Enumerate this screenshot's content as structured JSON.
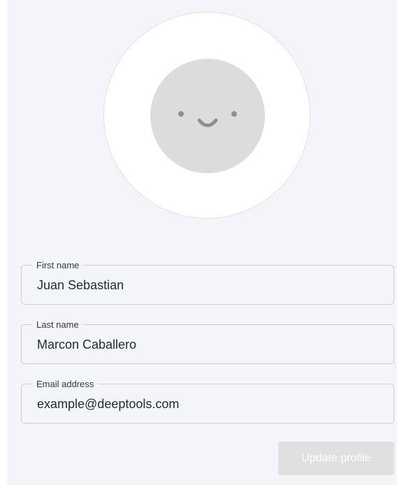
{
  "profile": {
    "avatar": {
      "icon": "smiley-face-icon",
      "ring_color": "#ffffff",
      "face_color": "#dcdcdc"
    },
    "fields": [
      {
        "label": "First name",
        "value": "Juan Sebastian"
      },
      {
        "label": "Last name",
        "value": "Marcon Caballero"
      },
      {
        "label": "Email address",
        "value": "example@deeptools.com"
      }
    ],
    "update_button_label": "Update profile",
    "update_button_state": "disabled"
  },
  "colors": {
    "background": "#f3f5f8",
    "field_border": "#c9ccd1",
    "button_disabled_bg": "#e0e0e0",
    "button_disabled_text": "#ffffff"
  }
}
